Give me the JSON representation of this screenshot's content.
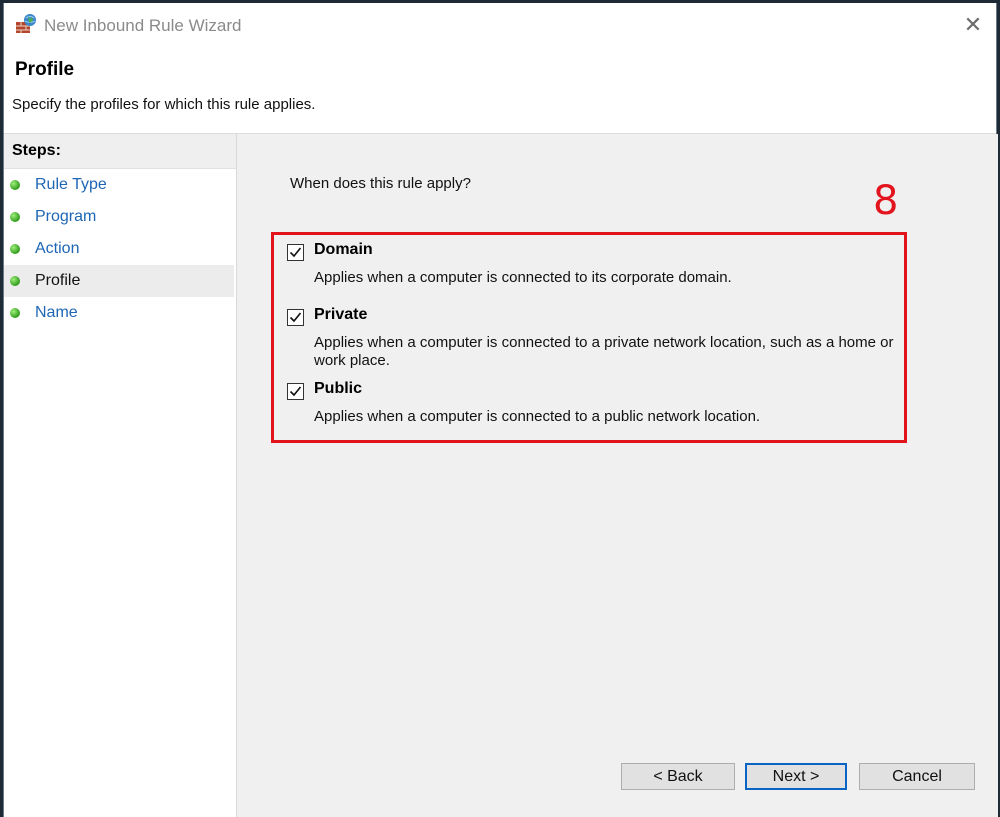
{
  "window": {
    "title": "New Inbound Rule Wizard",
    "icon": "firewall-globe-icon",
    "close_symbol": "✕"
  },
  "header": {
    "title": "Profile",
    "subtitle": "Specify the profiles for which this rule applies."
  },
  "steps": {
    "heading": "Steps:",
    "items": [
      {
        "label": "Rule Type",
        "current": false
      },
      {
        "label": "Program",
        "current": false
      },
      {
        "label": "Action",
        "current": false
      },
      {
        "label": "Profile",
        "current": true
      },
      {
        "label": "Name",
        "current": false
      }
    ]
  },
  "main": {
    "question": "When does this rule apply?",
    "options": [
      {
        "label": "Domain",
        "checked": true,
        "description": "Applies when a computer is connected to its corporate domain."
      },
      {
        "label": "Private",
        "checked": true,
        "description": "Applies when a computer is connected to a private network location, such as a home or work place."
      },
      {
        "label": "Public",
        "checked": true,
        "description": "Applies when a computer is connected to a public network location."
      }
    ]
  },
  "annotation": {
    "number": "8",
    "color": "#e3131c"
  },
  "buttons": {
    "back": "< Back",
    "next": "Next >",
    "cancel": "Cancel"
  },
  "colors": {
    "link": "#1e66b5",
    "primary_border": "#0a64c4"
  }
}
